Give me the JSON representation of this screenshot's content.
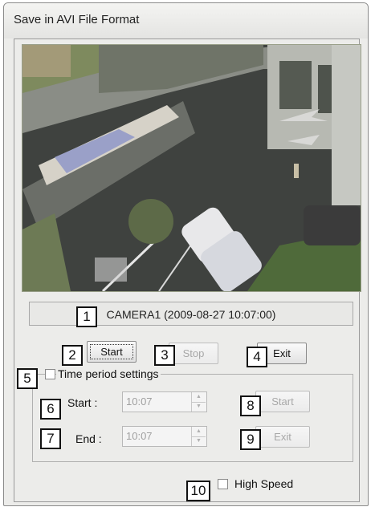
{
  "window": {
    "title": "Save in AVI File Format"
  },
  "status": {
    "text": "CAMERA1 (2009-08-27  10:07:00)"
  },
  "buttons": {
    "start": "Start",
    "stop": "Stop",
    "exit": "Exit"
  },
  "time_period": {
    "checkbox_label": "Time period settings",
    "start_label": "Start :",
    "end_label": "End :",
    "start_value": "10:07",
    "end_value": "10:07",
    "start_button": "Start",
    "exit_button": "Exit"
  },
  "high_speed": {
    "label": "High Speed"
  },
  "callouts": [
    "1",
    "2",
    "3",
    "4",
    "5",
    "6",
    "7",
    "8",
    "9",
    "10"
  ]
}
